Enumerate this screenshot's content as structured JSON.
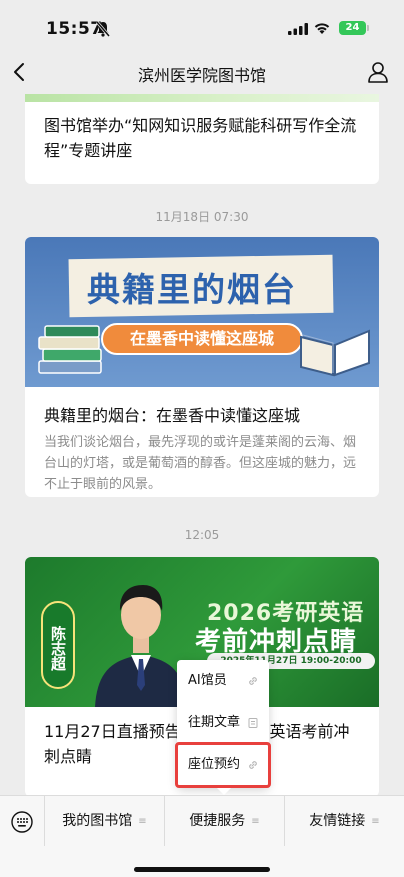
{
  "status_bar": {
    "time": "15:57",
    "battery": "24"
  },
  "nav": {
    "title": "滨州医学院图书馆"
  },
  "feed": {
    "card1_title": "图书馆举办“知网知识服务赋能科研写作全流程”专题讲座",
    "timestamp1": "11月18日 07:30",
    "card2": {
      "banner_title": "典籍里的烟台",
      "banner_subtitle": "在墨香中读懂这座城",
      "title": "典籍里的烟台：在墨香中读懂这座城",
      "desc": "当我们谈论烟台，最先浮现的或许是蓬莱阁的云海、烟台山的灯塔，或是葡萄酒的醇香。但这座城的魅力，远不止于眼前的风景。"
    },
    "timestamp2": "12:05",
    "card3": {
      "badge_name": "陈志超",
      "headline1": "2026考研英语",
      "headline2": "考前冲刺点睛",
      "date": "2025年11月27日 19:00-20:00",
      "title": "11月27日直播预告｜2026考研英语考前冲刺点睛"
    }
  },
  "popup_menu": {
    "items": [
      {
        "label": "AI馆员",
        "icon": "link-icon"
      },
      {
        "label": "往期文章",
        "icon": "page-icon"
      },
      {
        "label": "座位预约",
        "icon": "link-icon"
      }
    ]
  },
  "bottom_menu": {
    "items": [
      {
        "label": "我的图书馆"
      },
      {
        "label": "便捷服务"
      },
      {
        "label": "友情链接"
      }
    ]
  },
  "colors": {
    "highlight": "#e8403d",
    "battery": "#34c759",
    "banner_blue": "#4a78b8",
    "banner_green": "#1d7a2c"
  }
}
